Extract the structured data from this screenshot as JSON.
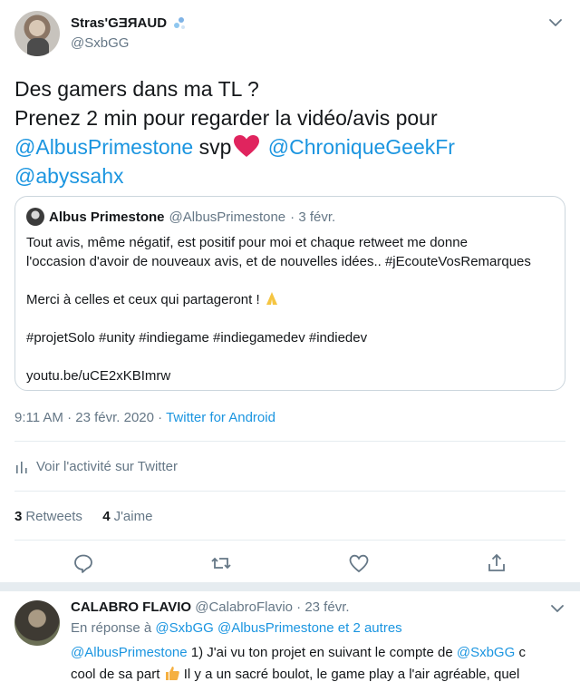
{
  "tweet": {
    "display_name": "Stras'GƎЯAUD",
    "handle": "@SxbGG",
    "text": {
      "line1": "Des gamers dans ma TL ?",
      "line2": "Prenez 2 min pour regarder la vidéo/avis pour",
      "mention1": "@AlbusPrimestone",
      "svp": "svp",
      "mention2": "@ChroniqueGeekFr",
      "mention3": "@abyssahx"
    },
    "quote": {
      "name": "Albus Primestone",
      "handle": "@AlbusPrimestone",
      "date": "· 3 févr.",
      "line1": "Tout avis, même négatif, est positif pour moi et chaque retweet me donne",
      "line2": "l'occasion d'avoir de nouveaux avis, et de nouvelles idées.. #jEcouteVosRemarques",
      "line3": "Merci à celles et ceux qui partageront !",
      "hashtags": "#projetSolo #unity #indiegame #indiegamedev #indiedev",
      "link": "youtu.be/uCE2xKBImrw"
    },
    "timestamp": "9:11 AM · 23 févr. 2020 ·",
    "source": "Twitter for Android",
    "activity_label": "Voir l'activité sur Twitter",
    "retweets_count": "3",
    "retweets_label": "Retweets",
    "likes_count": "4",
    "likes_label": "J'aime",
    "icons": [
      "chevron-down-icon",
      "reply-icon",
      "retweet-icon",
      "like-icon",
      "share-icon",
      "bars-icon"
    ],
    "accent": "#1b95e0"
  },
  "reply": {
    "name": "CALABRO FLAVIO",
    "handle": "@CalabroFlavio",
    "date": "· 23 févr.",
    "replying_prefix": "En réponse à",
    "replying_users": "@SxbGG @AlbusPrimestone",
    "replying_others": "et 2 autres",
    "mention": "@AlbusPrimestone",
    "body1_mid": "1) J'ai vu ton projet en suivant le compte de",
    "mention2": "@SxbGG",
    "body1_end": "c",
    "body2_start": "cool de sa part",
    "body2_end": "Il y a un sacré boulot, le game play a l'air agréable, quel"
  }
}
